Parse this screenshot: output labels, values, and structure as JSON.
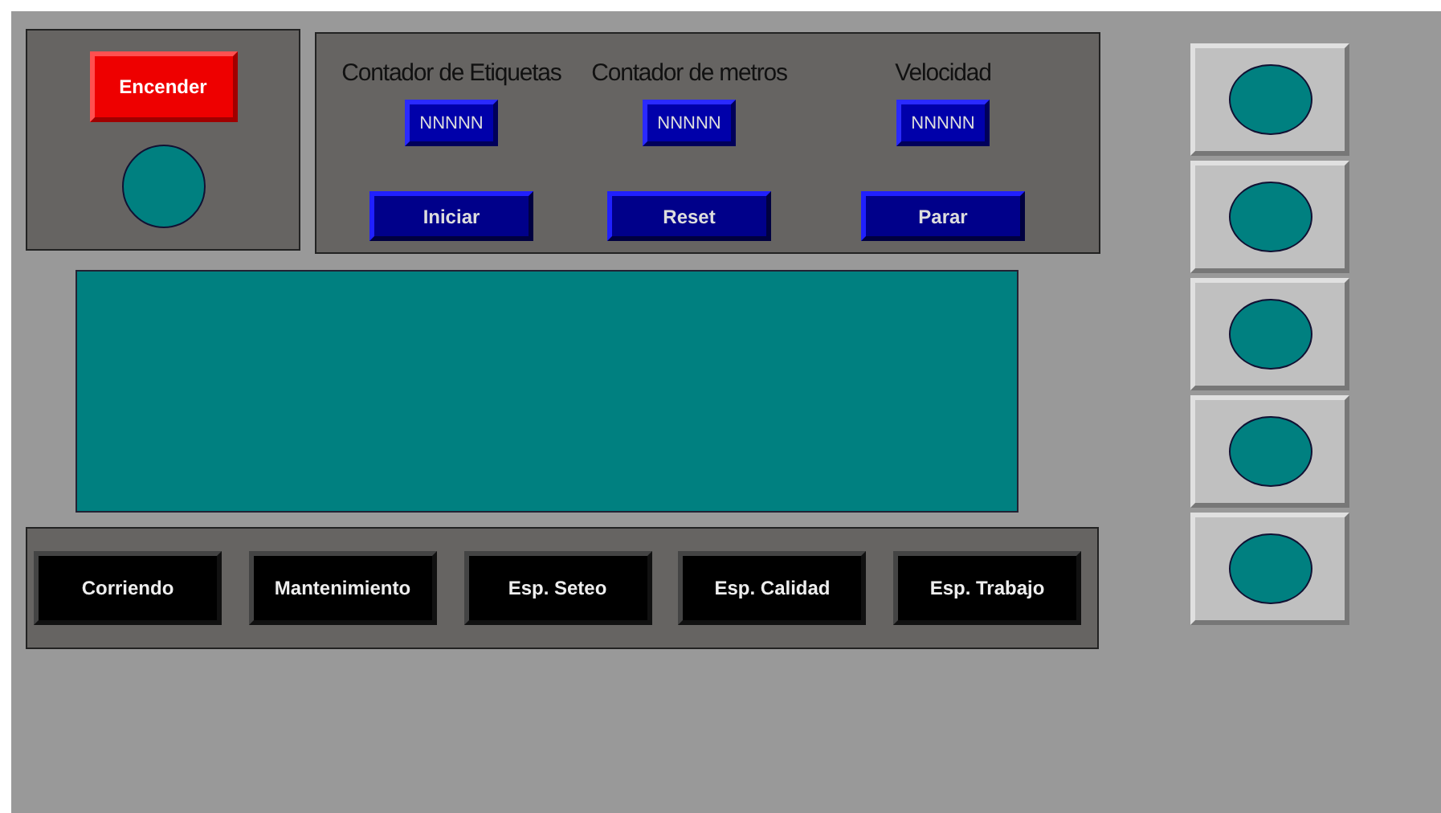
{
  "power": {
    "button": "Encender",
    "lamp": {
      "kind": "lamp"
    }
  },
  "counters": [
    {
      "label": "Contador de Etiquetas",
      "value": "NNNNN",
      "button": "Iniciar"
    },
    {
      "label": "Contador de metros",
      "value": "NNNNN",
      "button": "Reset"
    },
    {
      "label": "Velocidad",
      "value": "NNNNN",
      "button": "Parar"
    }
  ],
  "display": {
    "kind": "screen"
  },
  "states": [
    "Corriendo",
    "Mantenimiento",
    "Esp. Seteo",
    "Esp. Calidad",
    "Esp. Trabajo"
  ],
  "side_buttons": [
    {
      "kind": "lamp"
    },
    {
      "kind": "lamp"
    },
    {
      "kind": "lamp"
    },
    {
      "kind": "lamp"
    },
    {
      "kind": "lamp"
    }
  ]
}
